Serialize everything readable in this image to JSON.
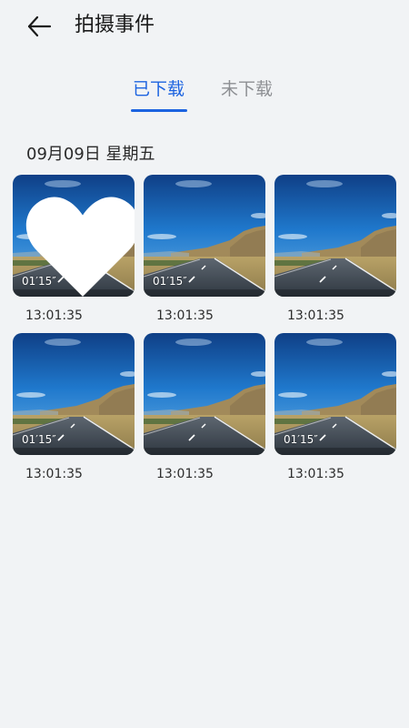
{
  "header": {
    "title": "拍摄事件",
    "back_icon": "arrow-left-icon"
  },
  "tabs": [
    {
      "label": "已下载",
      "active": true
    },
    {
      "label": "未下载",
      "active": false
    }
  ],
  "accent_color": "#1c63e0",
  "section": {
    "date": "09月09日 星期五",
    "items": [
      {
        "duration": "01′15″",
        "time": "13:01:35",
        "favorited": true
      },
      {
        "duration": "01′15″",
        "time": "13:01:35",
        "favorited": false
      },
      {
        "duration": "",
        "time": "13:01:35",
        "favorited": false
      },
      {
        "duration": "01′15″",
        "time": "13:01:35",
        "favorited": false
      },
      {
        "duration": "",
        "time": "13:01:35",
        "favorited": false
      },
      {
        "duration": "01′15″",
        "time": "13:01:35",
        "favorited": false
      }
    ]
  }
}
